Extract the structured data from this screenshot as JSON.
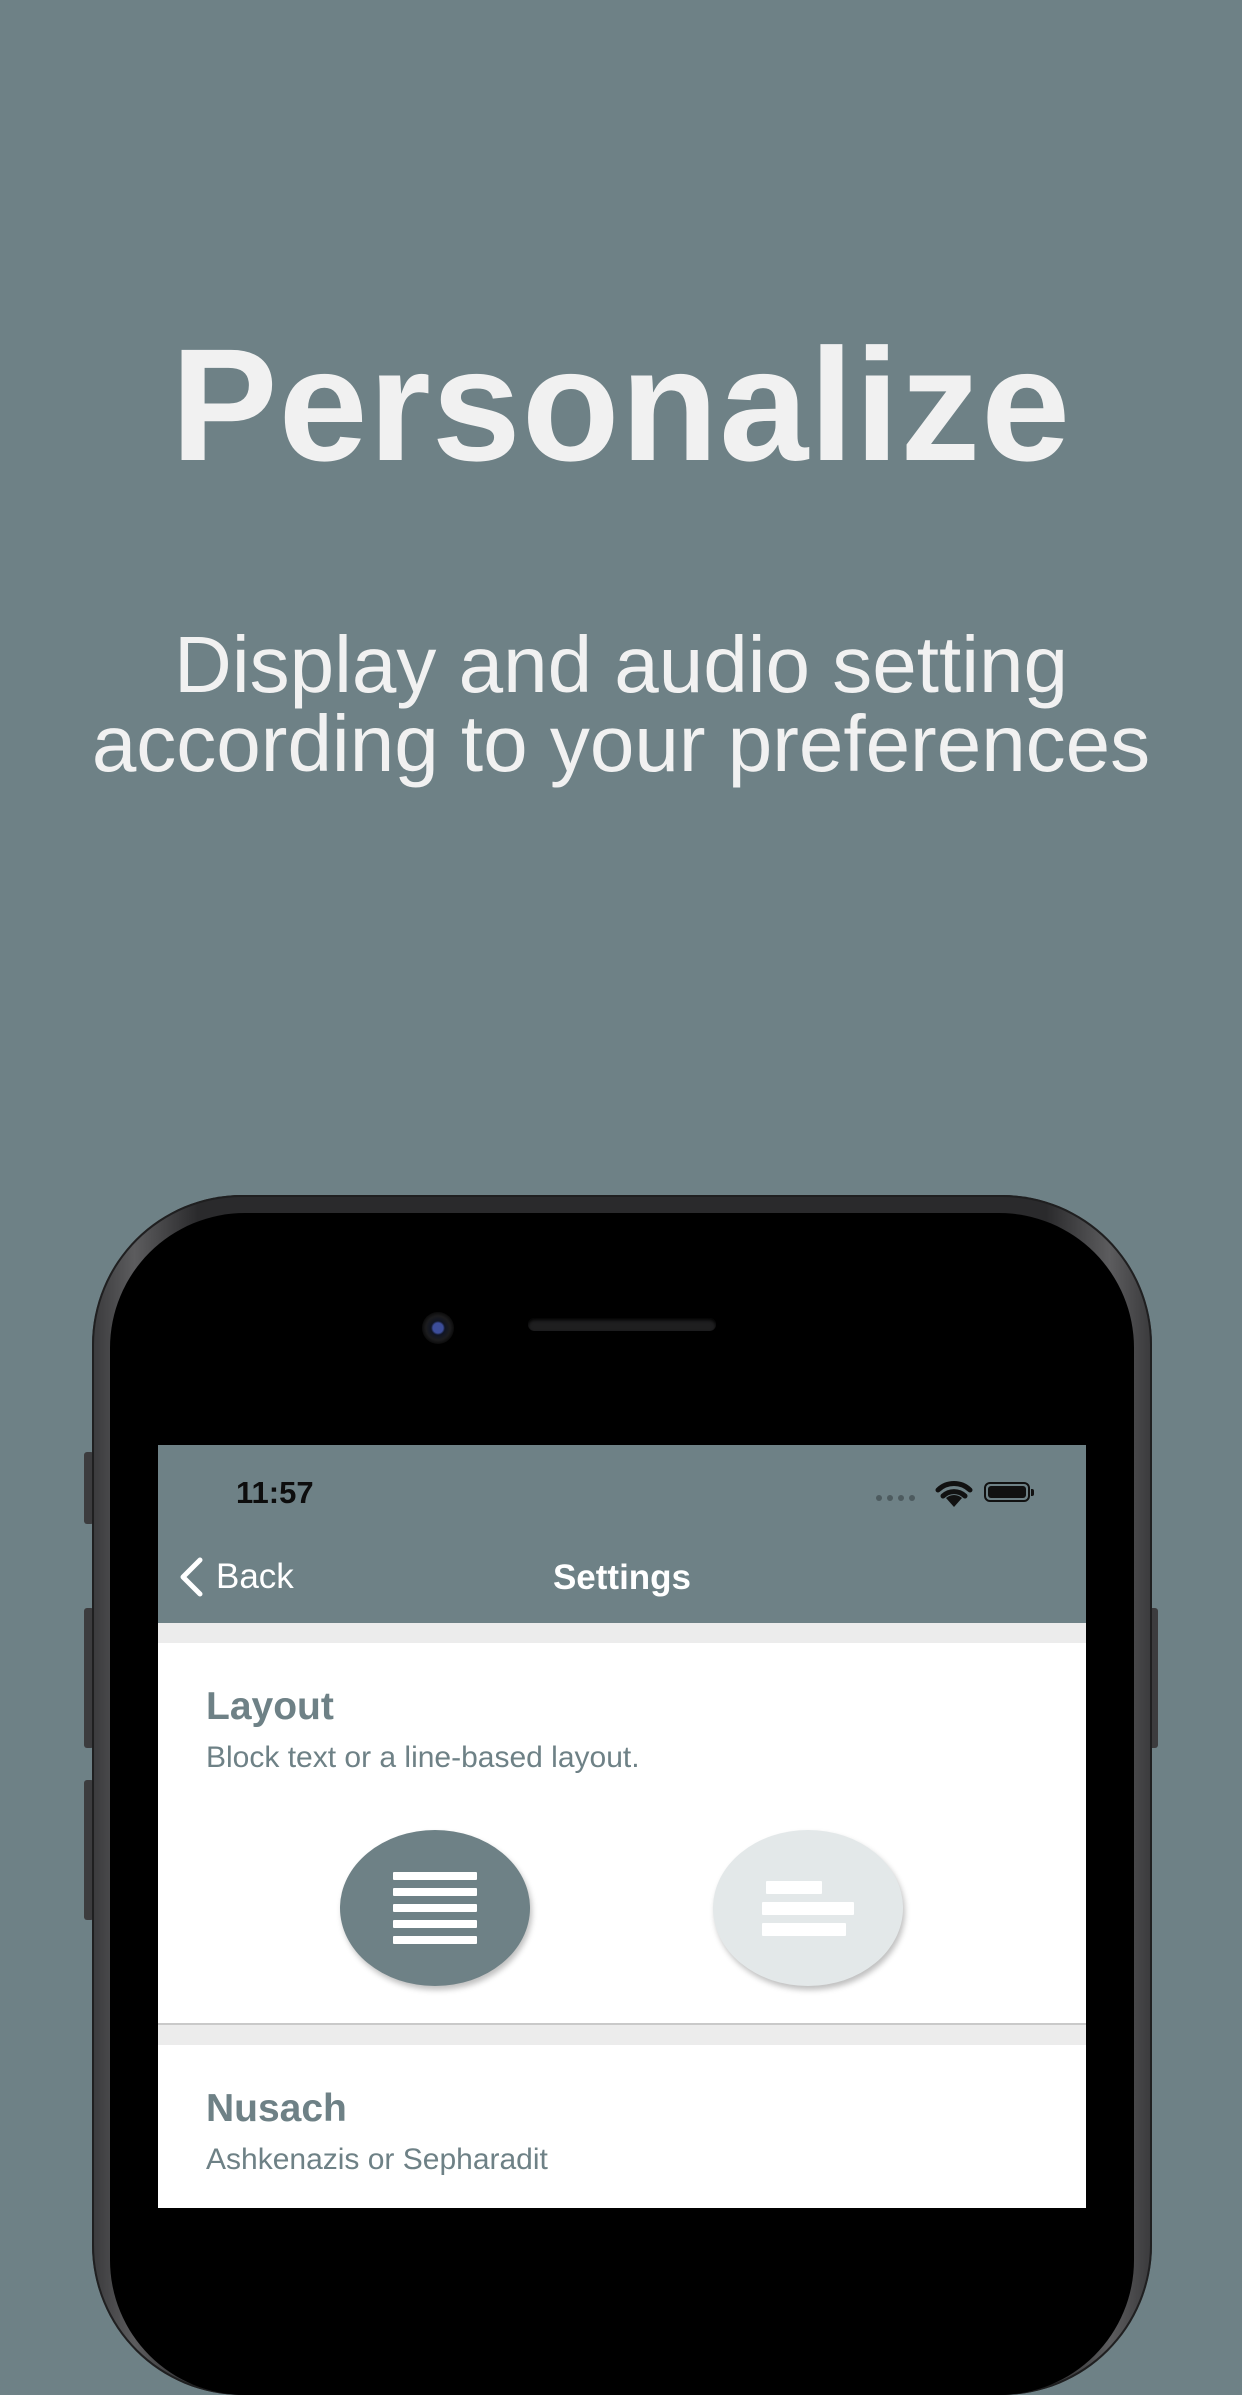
{
  "promo": {
    "headline": "Personalize",
    "subline_1": "Display and audio setting",
    "subline_2": "according to your preferences"
  },
  "status_bar": {
    "time": "11:57"
  },
  "nav": {
    "back_label": "Back",
    "title": "Settings"
  },
  "settings": {
    "layout": {
      "title": "Layout",
      "description": "Block text or a line-based layout.",
      "selected": "block"
    },
    "nusach": {
      "title": "Nusach",
      "description": "Ashkenazis or Sepharadit"
    }
  },
  "colors": {
    "background": "#6e8186",
    "accent": "#6e8186",
    "card": "#ffffff",
    "inactive_option": "#e3e8e9"
  }
}
